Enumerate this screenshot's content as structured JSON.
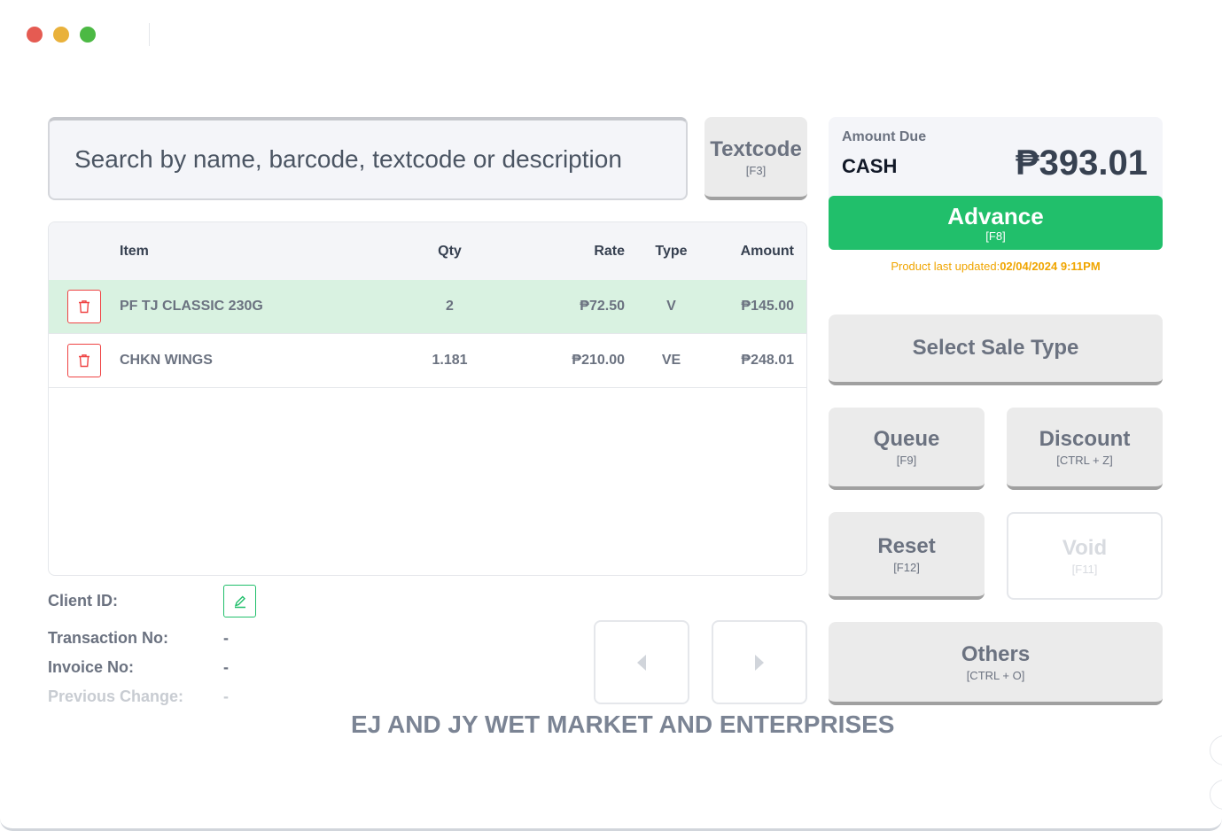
{
  "window": {
    "controls": [
      "close",
      "minimize",
      "maximize"
    ]
  },
  "search": {
    "placeholder": "Search by name, barcode, textcode or description",
    "value": ""
  },
  "textcode_button": {
    "label": "Textcode",
    "shortcut": "[F3]"
  },
  "table": {
    "columns": {
      "item": "Item",
      "qty": "Qty",
      "rate": "Rate",
      "type": "Type",
      "amount": "Amount"
    },
    "rows": [
      {
        "item": "PF TJ CLASSIC 230G",
        "qty": "2",
        "rate": "₱72.50",
        "type": "V",
        "amount": "₱145.00",
        "selected": true
      },
      {
        "item": "CHKN WINGS",
        "qty": "1.181",
        "rate": "₱210.00",
        "type": "VE",
        "amount": "₱248.01",
        "selected": false
      }
    ]
  },
  "amount_due": {
    "label": "Amount Due",
    "method": "CASH",
    "value": "₱393.01"
  },
  "advance_button": {
    "label": "Advance",
    "shortcut": "[F8]",
    "color": "#21bf6b"
  },
  "product_update": {
    "label": "Product last updated:",
    "timestamp": "02/04/2024 9:11PM",
    "color": "#f0a500"
  },
  "sale_type_button": {
    "label": "Select Sale Type"
  },
  "queue_button": {
    "label": "Queue",
    "shortcut": "[F9]"
  },
  "discount_button": {
    "label": "Discount",
    "shortcut": "[CTRL + Z]"
  },
  "reset_button": {
    "label": "Reset",
    "shortcut": "[F12]"
  },
  "void_button": {
    "label": "Void",
    "shortcut": "[F11]",
    "disabled": true
  },
  "others_button": {
    "label": "Others",
    "shortcut": "[CTRL + O]"
  },
  "transaction_info": {
    "client_id_label": "Client ID:",
    "transaction_no_label": "Transaction No:",
    "transaction_no": "-",
    "invoice_no_label": "Invoice No:",
    "invoice_no": "-",
    "previous_change_label": "Previous Change:",
    "previous_change": "-"
  },
  "icons": {
    "delete": "trash-icon",
    "edit": "pencil-icon",
    "prev": "caret-left-icon",
    "next": "caret-right-icon"
  },
  "store_name": "EJ AND JY WET MARKET AND ENTERPRISES"
}
